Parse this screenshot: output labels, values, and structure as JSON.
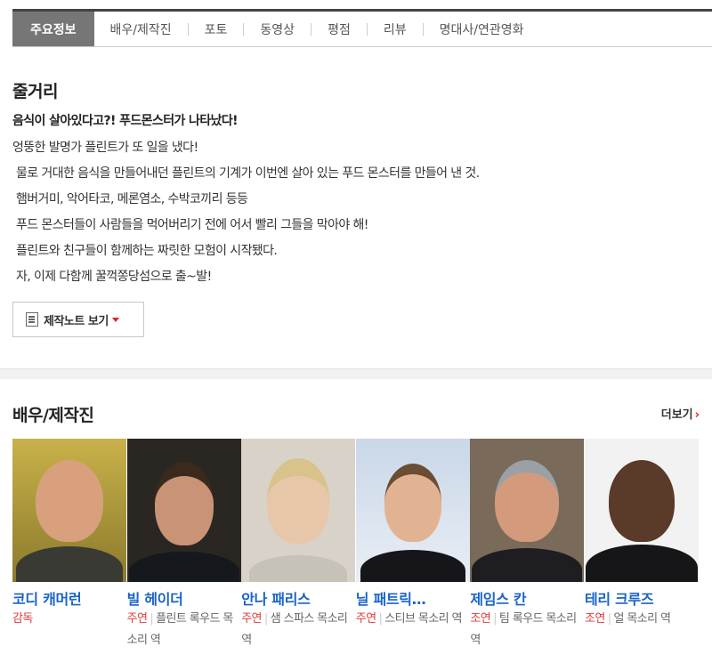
{
  "tabs": [
    "주요정보",
    "배우/제작진",
    "포토",
    "동영상",
    "평점",
    "리뷰",
    "명대사/연관영화"
  ],
  "synopsis": {
    "title": "줄거리",
    "headline": "음식이 살아있다고?! 푸드몬스터가 나타났다!",
    "lines": [
      "엉뚱한 발명가 플린트가 또 일을 냈다!",
      "물로 거대한 음식을 만들어내던 플린트의 기계가 이번엔 살아 있는 푸드 몬스터를 만들어 낸 것.",
      "햄버거미, 악어타코, 메론염소, 수박코끼리 등등",
      "푸드 몬스터들이 사람들을 먹어버리기 전에 어서 빨리 그들을 막아야 해!",
      "플린트와 친구들이 함께하는 짜릿한 모험이 시작됐다.",
      "자, 이제 다함께 꿀꺽쫑당섬으로 출~발!"
    ],
    "note_button": "제작노트 보기"
  },
  "cast": {
    "title": "배우/제작진",
    "more": "더보기",
    "people": [
      {
        "name": "코디 캐머런",
        "kind": "감독",
        "role": ""
      },
      {
        "name": "빌 헤이더",
        "kind": "주연",
        "role": "플린트 록우드 목소리 역"
      },
      {
        "name": "안나 패리스",
        "kind": "주연",
        "role": "샘 스파스 목소리 역"
      },
      {
        "name": "닐 패트릭…",
        "kind": "주연",
        "role": "스티브 목소리 역"
      },
      {
        "name": "제임스 칸",
        "kind": "조연",
        "role": "팀 록우드 목소리 역"
      },
      {
        "name": "테리 크루즈",
        "kind": "조연",
        "role": "얼 목소리 역"
      }
    ]
  },
  "colors": {
    "active_tab": "#767676",
    "link_blue": "#1a63c8",
    "accent_red": "#e03a3a"
  }
}
